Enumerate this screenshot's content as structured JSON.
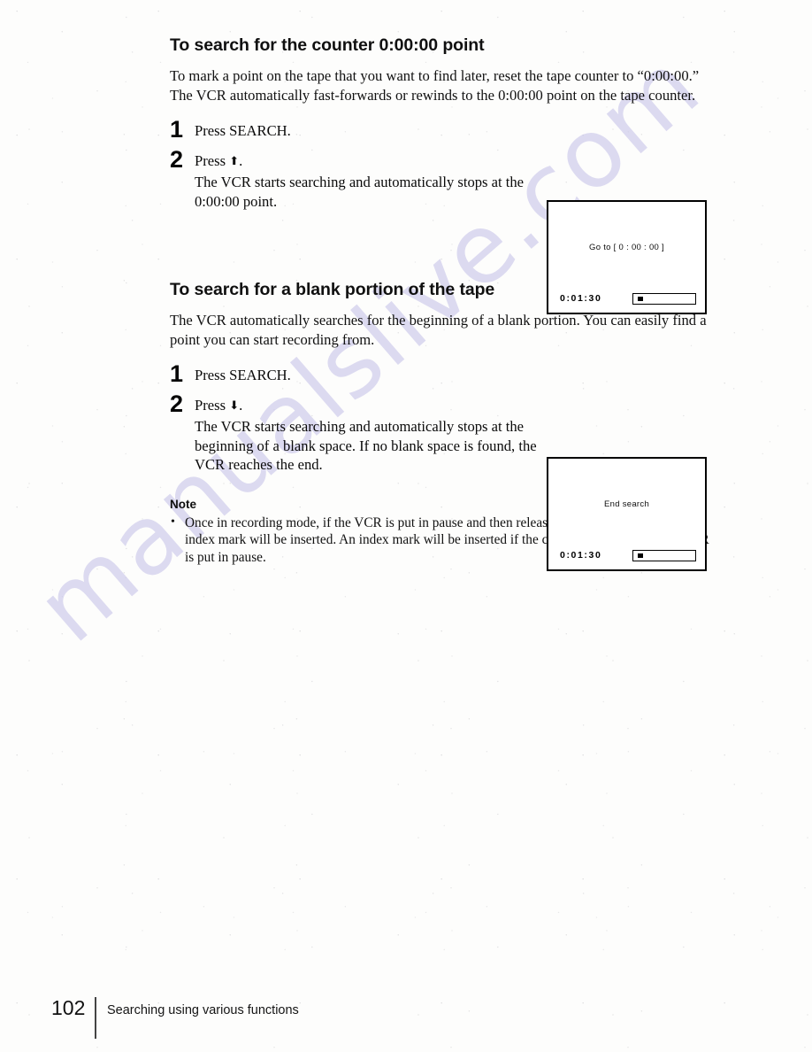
{
  "watermark": {
    "text": "manualslive.com"
  },
  "sections": [
    {
      "heading": "To search for the counter 0:00:00 point",
      "intro": "To mark a point on the tape that you want to find later, reset the tape counter to “0:00:00.” The VCR automatically fast-forwards or rewinds to the 0:00:00 point on the tape counter.",
      "steps": [
        {
          "number": "1",
          "title": "Press SEARCH.",
          "detail": ""
        },
        {
          "number": "2",
          "title": "Press ",
          "arrow": "⬆",
          "title_suffix": ".",
          "detail": "The VCR starts searching and automatically stops at the 0:00:00 point."
        }
      ],
      "screen": {
        "message": "Go to [ 0 : 00 : 00 ]",
        "counter": "0:01:30"
      }
    },
    {
      "heading": "To search for a blank portion of the tape",
      "intro": "The VCR automatically searches for the beginning of a blank portion.  You can easily find a point you can start recording from.",
      "steps": [
        {
          "number": "1",
          "title": "Press SEARCH.",
          "detail": ""
        },
        {
          "number": "2",
          "title": "Press ",
          "arrow": "⬇",
          "title_suffix": ".",
          "detail": "The VCR starts searching and automatically stops at the beginning of a blank space.  If no blank space is found, the VCR reaches the end."
        }
      ],
      "screen": {
        "message": "End search",
        "counter": "0:01:30"
      }
    }
  ],
  "note": {
    "title": "Note",
    "bullet": "•",
    "text": "Once in recording mode, if the VCR is put in pause and then released to start the recording, no index mark will be inserted.  An index mark will be inserted if the channel is changed while VCR is put in pause."
  },
  "footer": {
    "page_number": "102",
    "title": "Searching using various functions"
  }
}
